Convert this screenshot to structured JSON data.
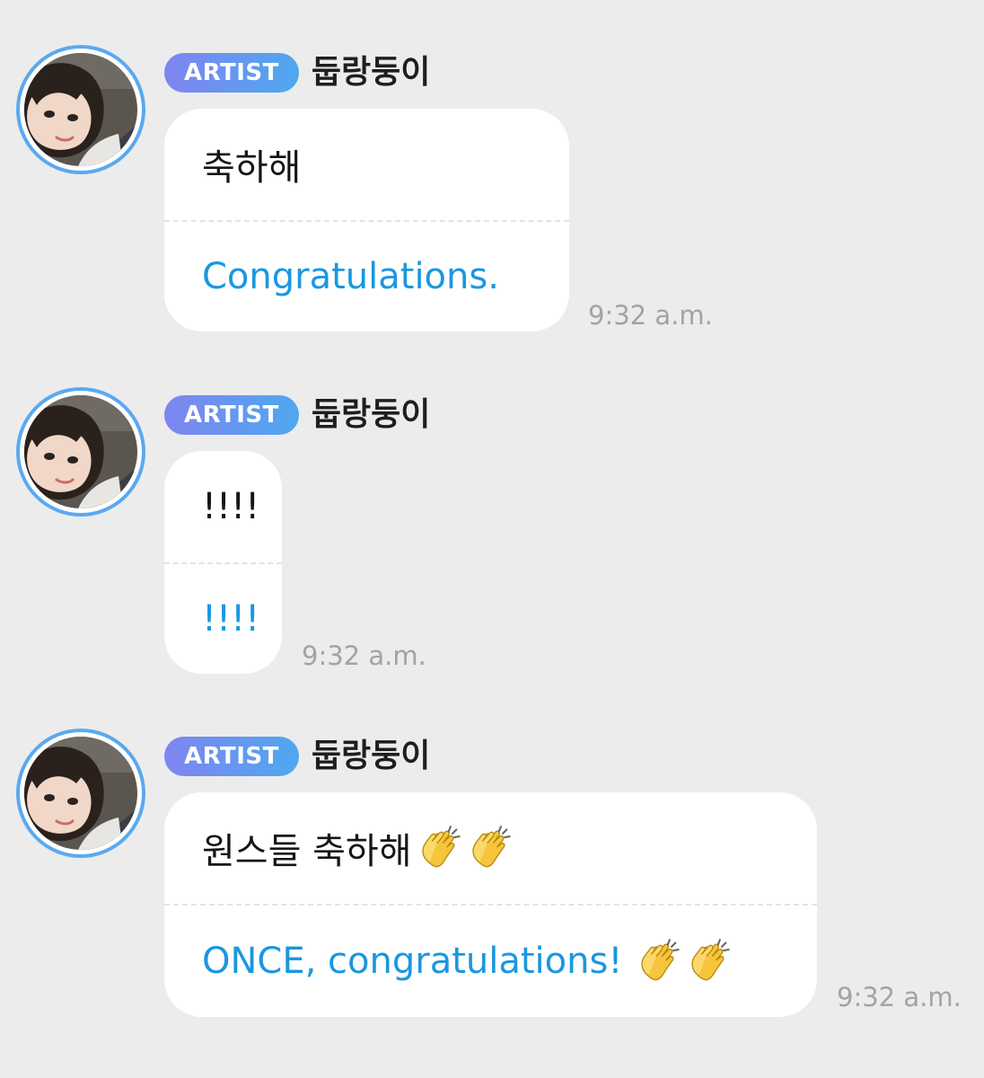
{
  "messages": [
    {
      "badge": "ARTIST",
      "username": "둡랑둥이",
      "original": "축하해",
      "translation": "Congratulations.",
      "time": "9:32 a.m.",
      "emoji": []
    },
    {
      "badge": "ARTIST",
      "username": "둡랑둥이",
      "original": "!!!!",
      "translation": "!!!!",
      "time": "9:32 a.m.",
      "emoji": []
    },
    {
      "badge": "ARTIST",
      "username": "둡랑둥이",
      "original": "원스들 축하해",
      "translation": "ONCE, congratulations!",
      "time": "9:32 a.m.",
      "emoji": [
        "clapping-hands",
        "clapping-hands"
      ]
    }
  ],
  "colors": {
    "background": "#ececec",
    "bubble": "#ffffff",
    "translation_text": "#1a97e0",
    "badge_gradient_start": "#7f85f0",
    "badge_gradient_end": "#4ea8ef",
    "avatar_ring": "#5aa9f0",
    "timestamp": "#a3a3a3"
  }
}
